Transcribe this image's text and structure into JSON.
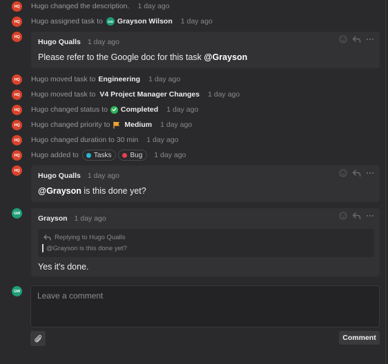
{
  "avatars": {
    "hugo": {
      "initials": "HQ",
      "color": "#d9432b"
    },
    "grayson": {
      "initials": "GW",
      "color": "#1e9e78"
    }
  },
  "activities": [
    {
      "text": "Hugo changed the description.",
      "time": "1 day ago"
    },
    {
      "text": "Hugo assigned task to",
      "assignee_initials": "GW",
      "assignee": "Grayson Wilson",
      "time": "1 day ago"
    },
    {
      "text": "Hugo moved task to",
      "target": "Engineering",
      "time": "1 day ago"
    },
    {
      "text": "Hugo moved task to",
      "target": "V4 Project Manager Changes",
      "time": "1 day ago"
    },
    {
      "text": "Hugo changed status to",
      "status": "Completed",
      "status_icon": "check-circle-icon",
      "status_color": "#2fb55a",
      "time": "1 day ago"
    },
    {
      "text": "Hugo changed priority to",
      "priority": "Medium",
      "priority_icon": "flag-icon",
      "priority_color": "#f0a830",
      "time": "1 day ago"
    },
    {
      "text": "Hugo changed duration to 30 min",
      "time": "1 day ago"
    },
    {
      "text": "Hugo added to",
      "tags": [
        {
          "label": "Tasks",
          "color": "#29b6d6"
        },
        {
          "label": "Bug",
          "color": "#e8404f"
        }
      ],
      "time": "1 day ago"
    }
  ],
  "comments": [
    {
      "author": "Hugo Qualls",
      "time": "1 day ago",
      "body_text": "Please refer to the Google doc for this task ",
      "mention": "@Grayson"
    },
    {
      "author": "Hugo Qualls",
      "time": "1 day ago",
      "mention": "@Grayson",
      "body_text": " is this done yet?"
    },
    {
      "author": "Grayson",
      "time": "1 day ago",
      "replying_label": "Replying to Hugo Qualls",
      "quote": "@Grayson is this done yet?",
      "body_text": "Yes it's done."
    }
  ],
  "composer": {
    "placeholder": "Leave a comment",
    "value": "",
    "submit_label": "Comment"
  }
}
